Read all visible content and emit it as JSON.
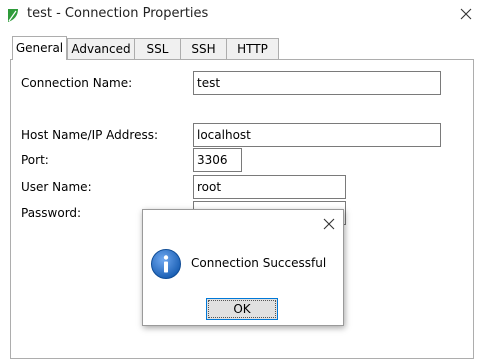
{
  "window": {
    "title": "test - Connection Properties",
    "app_icon": "leaf-icon",
    "close_icon": "close-icon"
  },
  "tabs": [
    {
      "label": "General",
      "active": true
    },
    {
      "label": "Advanced",
      "active": false
    },
    {
      "label": "SSL",
      "active": false
    },
    {
      "label": "SSH",
      "active": false
    },
    {
      "label": "HTTP",
      "active": false
    }
  ],
  "form": {
    "connection_name": {
      "label": "Connection Name:",
      "value": "test"
    },
    "host": {
      "label": "Host Name/IP Address:",
      "value": "localhost"
    },
    "port": {
      "label": "Port:",
      "value": "3306"
    },
    "user": {
      "label": "User Name:",
      "value": "root"
    },
    "password": {
      "label": "Password:",
      "value": "●●●●●●"
    }
  },
  "dialog": {
    "message": "Connection Successful",
    "ok_label": "OK",
    "icon": "info-icon",
    "close_icon": "close-icon"
  },
  "colors": {
    "accent": "#0078d7",
    "info_icon": "#1a5fb4",
    "app_icon": "#2e9b3a"
  }
}
